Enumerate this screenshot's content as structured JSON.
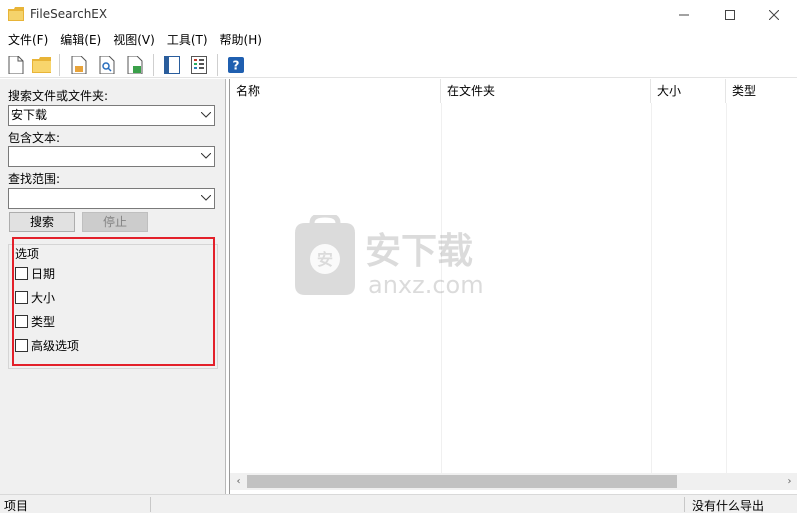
{
  "window": {
    "title": "FileSearchEX",
    "minimize": "—",
    "maximize": "☐",
    "close": "✕"
  },
  "menu": [
    "文件(F)",
    "编辑(E)",
    "视图(V)",
    "工具(T)",
    "帮助(H)"
  ],
  "toolbar": {
    "icons": [
      "new-file-icon",
      "open-folder-icon",
      "save-icon",
      "find-icon",
      "export-icon",
      "panel-icon",
      "columns-icon",
      "help-icon"
    ]
  },
  "search": {
    "name_label": "搜索文件或文件夹:",
    "name_value": "安下载",
    "text_label": "包含文本:",
    "text_value": "",
    "scope_label": "查找范围:",
    "scope_value": "",
    "search_button": "搜索",
    "stop_button": "停止"
  },
  "options": {
    "title": "选项",
    "items": [
      {
        "label": "日期",
        "checked": false
      },
      {
        "label": "大小",
        "checked": false
      },
      {
        "label": "类型",
        "checked": false
      },
      {
        "label": "高级选项",
        "checked": false
      }
    ],
    "highlight_color": "#e3202a"
  },
  "results": {
    "columns": [
      "名称",
      "在文件夹",
      "大小",
      "类型"
    ],
    "rows": []
  },
  "watermark": {
    "text": "安下载",
    "subtext": "anxz.com"
  },
  "status": {
    "left": "项目",
    "right": "没有什么导出"
  }
}
